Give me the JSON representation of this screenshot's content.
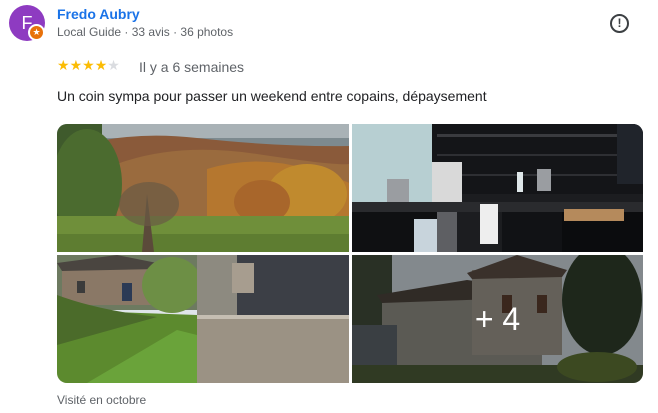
{
  "reviewer": {
    "initial": "F",
    "name": "Fredo Aubry",
    "meta": "Local Guide · 33 avis · 36 photos",
    "badge_icon": "local-guide-star-icon",
    "avatar_color": "#8e3bc1"
  },
  "review": {
    "rating": 4,
    "rating_max": 5,
    "date": "Il y a 6 semaines",
    "text": "Un coin sympa pour passer un weekend entre copains, dépaysement",
    "visited": "Visité en octobre"
  },
  "photos": {
    "items": [
      {
        "name": "autumn-forest-meadow"
      },
      {
        "name": "kitchen-interior"
      },
      {
        "name": "garden-stone-houses"
      },
      {
        "name": "stone-house-exterior"
      }
    ],
    "more_label": "+ 4"
  },
  "actions": {
    "report_icon": "report-icon"
  },
  "colors": {
    "name_link": "#1a73e8",
    "star": "#fbbc04",
    "star_empty": "#dadce0",
    "badge": "#e8710a"
  }
}
